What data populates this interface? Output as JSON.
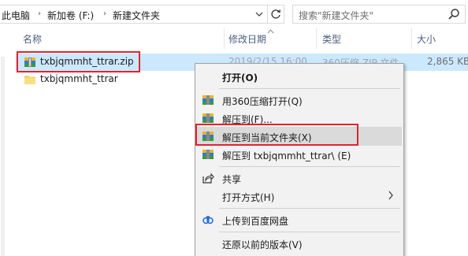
{
  "address": {
    "crumbs": [
      "此电脑",
      "新加卷 (F:)",
      "新建文件夹"
    ],
    "sep": "›",
    "dropdown_icon": "chevron-down-icon",
    "refresh_icon": "refresh-icon"
  },
  "search": {
    "placeholder": "搜索\"新建文件夹\"",
    "icon": "search-icon"
  },
  "columns": {
    "name": "名称",
    "modified": "修改日期",
    "type": "类型",
    "size": "大小"
  },
  "files": [
    {
      "name": "txbjqmmht_ttrar.zip",
      "modified": "2019/2/15 16:00",
      "type": "360压缩 ZIP 文件",
      "size": "2,865 KB",
      "icon": "zip-archive-icon",
      "selected": true
    },
    {
      "name": "txbjqmmht_ttrar",
      "icon": "folder-icon",
      "selected": false
    }
  ],
  "context_menu": {
    "items": [
      {
        "label": "打开(O)",
        "bold": true,
        "icon": ""
      },
      {
        "label": "用360压缩打开(Q)",
        "icon": "archive-360-icon"
      },
      {
        "label": "解压到(F)...",
        "icon": "archive-360-icon"
      },
      {
        "label": "解压到当前文件夹(X)",
        "icon": "archive-360-icon",
        "highlighted": true
      },
      {
        "label": "解压到 txbjqmmht_ttrar\\ (E)",
        "icon": "archive-360-icon"
      },
      {
        "label": "共享",
        "icon": "share-icon"
      },
      {
        "label": "打开方式(H)",
        "icon": "",
        "submenu": true
      },
      {
        "label": "上传到百度网盘",
        "icon": "baidu-cloud-icon"
      },
      {
        "label": "还原以前的版本(V)",
        "icon": ""
      }
    ]
  },
  "colors": {
    "selection": "#cce8ff",
    "highlight_box": "#e0242e",
    "menu_bg": "#f2f2f2",
    "header_text": "#4c607a"
  }
}
